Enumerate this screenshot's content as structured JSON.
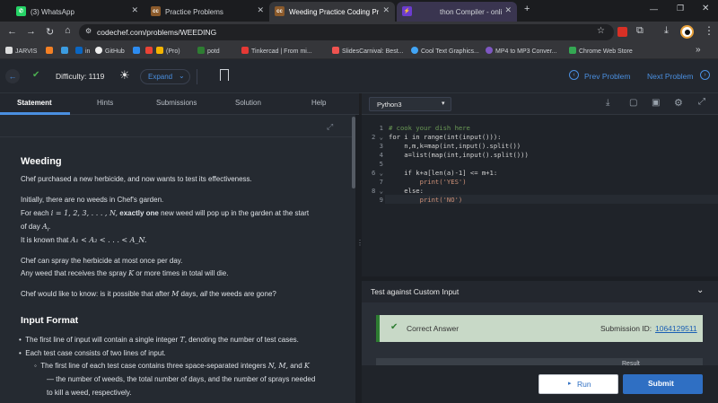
{
  "browser": {
    "tabs": [
      {
        "title": "(3) WhatsApp",
        "favicon": "whatsapp-icon",
        "color": "#25d366"
      },
      {
        "title": "Practice Problems",
        "favicon": "codechef-icon",
        "color": "#8b5a2b"
      },
      {
        "title": "Weeding Practice Coding Probl",
        "favicon": "codechef-icon",
        "color": "#8b5a2b"
      },
      {
        "title": "thon Compiler - onli",
        "favicon": "compiler-icon",
        "color": "#6c3ccf"
      }
    ],
    "url": "codechef.com/problems/WEEDING",
    "bookmarks": [
      "JARVIS",
      "in",
      "GitHub",
      "(Pro)",
      "potd",
      "Tinkercad | From mi...",
      "SlidesCarnival: Best...",
      "Cool Text Graphics...",
      "MP4 to MP3 Conver...",
      "Chrome Web Store"
    ]
  },
  "toolbar": {
    "difficulty_label": "Difficulty: 1119",
    "expand_label": "Expand",
    "prev_label": "Prev Problem",
    "next_label": "Next Problem"
  },
  "left_tabs": [
    "Statement",
    "Hints",
    "Submissions",
    "Solution",
    "Help"
  ],
  "problem": {
    "title": "Weeding",
    "intro": "Chef purchased a new herbicide, and now wants to test its effectiveness.",
    "line1": "Initially, there are no weeds in Chef's garden.",
    "line2a": "For each ",
    "line2math": "i = 1, 2, 3, . . . , N,",
    "line2b": " exactly one",
    "line2c": " new weed will pop up in the garden at the start",
    "line2d": "of day ",
    "line2dmath": "A",
    "line3a": "It is known that ",
    "line3math": "A₁ < A₂ < . . . < A_N.",
    "line4": "Chef can spray the herbicide at most once per day.",
    "line5a": "Any weed that receives the spray ",
    "line5math": "K",
    "line5b": " or more times in total will die.",
    "line6a": "Chef would like to know: is it possible that after ",
    "line6math": "M",
    "line6b": " days, ",
    "line6c": "all",
    "line6d": " the weeds are gone?",
    "input_heading": "Input Format",
    "bullet1a": "The first line of input will contain a single integer ",
    "bullet1math": "T",
    "bullet1b": ", denoting the number of test cases.",
    "bullet2": "Each test case consists of two lines of input.",
    "sub1a": "The first line of each test case contains three space-separated integers ",
    "sub1math": "N, M,",
    "sub1b": " and ",
    "sub1math2": "K",
    "sub1c": "— the number of weeds, the total number of days, and the number of sprays needed",
    "sub1d": "to kill a weed, respectively."
  },
  "editor": {
    "language": "Python3",
    "lines": [
      "# cook your dish here",
      "for i in range(int(input())):",
      "    n,m,k=map(int,input().split())",
      "    a=list(map(int,input().split()))",
      "",
      "    if k+a[len(a)-1] <= m+1:",
      "        print('YES')",
      "    else:",
      "        print('NO')"
    ]
  },
  "testing": {
    "heading": "Test against Custom Input",
    "status": "Correct Answer",
    "submission_label": "Submission ID:",
    "submission_id": "1064129511",
    "result_label": "Result"
  },
  "actions": {
    "run_label": "Run",
    "submit_label": "Submit"
  },
  "colors": {
    "accent": "#3b82d6",
    "submit_bg": "#2f6fc3",
    "success_bg": "#c8d9c7",
    "success_bar": "#2e7d32"
  }
}
